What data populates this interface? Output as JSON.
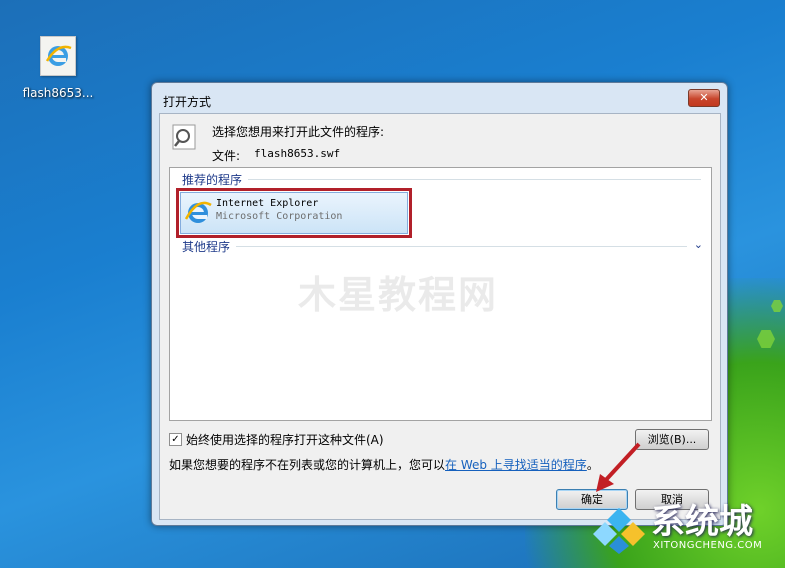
{
  "desktop": {
    "icon_label": "flash8653...",
    "brand_name": "系统城",
    "brand_url": "XITONGCHENG.COM"
  },
  "dialog": {
    "title": "打开方式",
    "close_label": "✕",
    "prompt": "选择您想用来打开此文件的程序:",
    "file_label": "文件:",
    "file_name": "flash8653.swf",
    "recommended_header": "推荐的程序",
    "other_header": "其他程序",
    "program": {
      "name": "Internet Explorer",
      "publisher": "Microsoft Corporation"
    },
    "watermark": "木星教程网",
    "always_use_label": "始终使用选择的程序打开这种文件(A)",
    "always_use_checked": true,
    "browse_label": "浏览(B)...",
    "hint_prefix": "如果您想要的程序不在列表或您的计算机上，您可以",
    "hint_link": "在 Web 上寻找适当的程序",
    "hint_suffix": "。",
    "ok_label": "确定",
    "cancel_label": "取消"
  },
  "colors": {
    "highlight_border": "#b1202a",
    "link": "#1560bd",
    "header_text": "#1e3a8a"
  }
}
